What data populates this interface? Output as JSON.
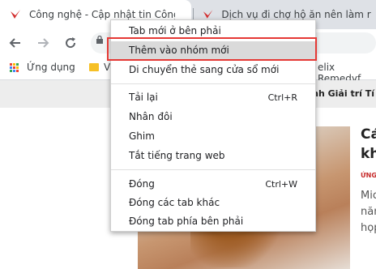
{
  "tabs": [
    {
      "title": "Công nghệ - Cập nhật tin Công"
    },
    {
      "title": "Dịch vụ đi chợ hộ ăn nên làm r"
    }
  ],
  "bookmarks": {
    "apps_label": "Ứng dụng",
    "folder_label": "V",
    "right_item": "elix Remedyf."
  },
  "site_nav": {
    "text": "anh  Giải trí  Tí"
  },
  "side_article": {
    "title_line1": "Cá",
    "title_line2": "kh",
    "category": "ỨNG",
    "line1": "Mic",
    "line2": "năm",
    "line3": "họp"
  },
  "context_menu": {
    "group1": [
      {
        "label": "Tab mới ở bên phải",
        "shortcut": ""
      },
      {
        "label": "Thêm vào nhóm mới",
        "shortcut": ""
      },
      {
        "label": "Di chuyển thẻ sang cửa sổ mới",
        "shortcut": ""
      }
    ],
    "group2": [
      {
        "label": "Tải lại",
        "shortcut": "Ctrl+R"
      },
      {
        "label": "Nhân đôi",
        "shortcut": ""
      },
      {
        "label": "Ghim",
        "shortcut": ""
      },
      {
        "label": "Tắt tiếng trang web",
        "shortcut": ""
      }
    ],
    "group3": [
      {
        "label": "Đóng",
        "shortcut": "Ctrl+W"
      },
      {
        "label": "Đóng các tab khác",
        "shortcut": ""
      },
      {
        "label": "Đóng tab phía bên phải",
        "shortcut": ""
      }
    ]
  },
  "colors": {
    "brand_red": "#d32f2f",
    "highlight_border": "#e53935"
  }
}
